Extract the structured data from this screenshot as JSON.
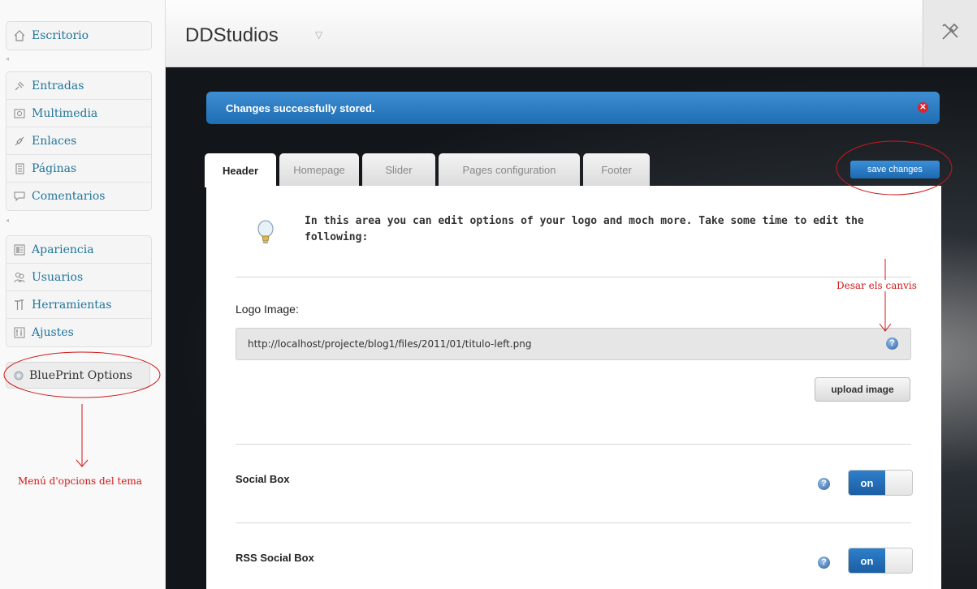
{
  "sidebar": {
    "groups": [
      [
        "Escritorio"
      ],
      [
        "Entradas",
        "Multimedia",
        "Enlaces",
        "Páginas",
        "Comentarios"
      ],
      [
        "Apariencia",
        "Usuarios",
        "Herramientas",
        "Ajustes"
      ]
    ],
    "escritorio": "Escritorio",
    "items": {
      "entradas": "Entradas",
      "multimedia": "Multimedia",
      "enlaces": "Enlaces",
      "paginas": "Páginas",
      "comentarios": "Comentarios",
      "apariencia": "Apariencia",
      "usuarios": "Usuarios",
      "herramientas": "Herramientas",
      "ajustes": "Ajustes"
    },
    "blueprint_options": "BluePrint Options"
  },
  "header": {
    "site_title": "DDStudios"
  },
  "notice": {
    "message": "Changes successfully stored."
  },
  "tabs": {
    "header": "Header",
    "homepage": "Homepage",
    "slider": "Slider",
    "pages_configuration": "Pages configuration",
    "footer": "Footer",
    "active": "Header"
  },
  "toolbar": {
    "save_label": "save changes"
  },
  "panel": {
    "intro": "In this area you can edit options of your logo and moch more. Take some time to edit the following:",
    "logo_image_label": "Logo Image:",
    "logo_image_value": "http://localhost/projecte/blog1/files/2011/01/titulo-left.png",
    "upload_label": "upload image",
    "social_box_label": "Social Box",
    "social_box_state": "on",
    "rss_social_box_label": "RSS Social Box",
    "rss_social_box_state": "on"
  },
  "annotations": {
    "save_note": "Desar els canvis",
    "menu_note": "Menú d'opcions del tema"
  },
  "colors": {
    "accent_blue": "#1f6db3",
    "annotation_red": "#d01818",
    "link_blue": "#21759b"
  }
}
